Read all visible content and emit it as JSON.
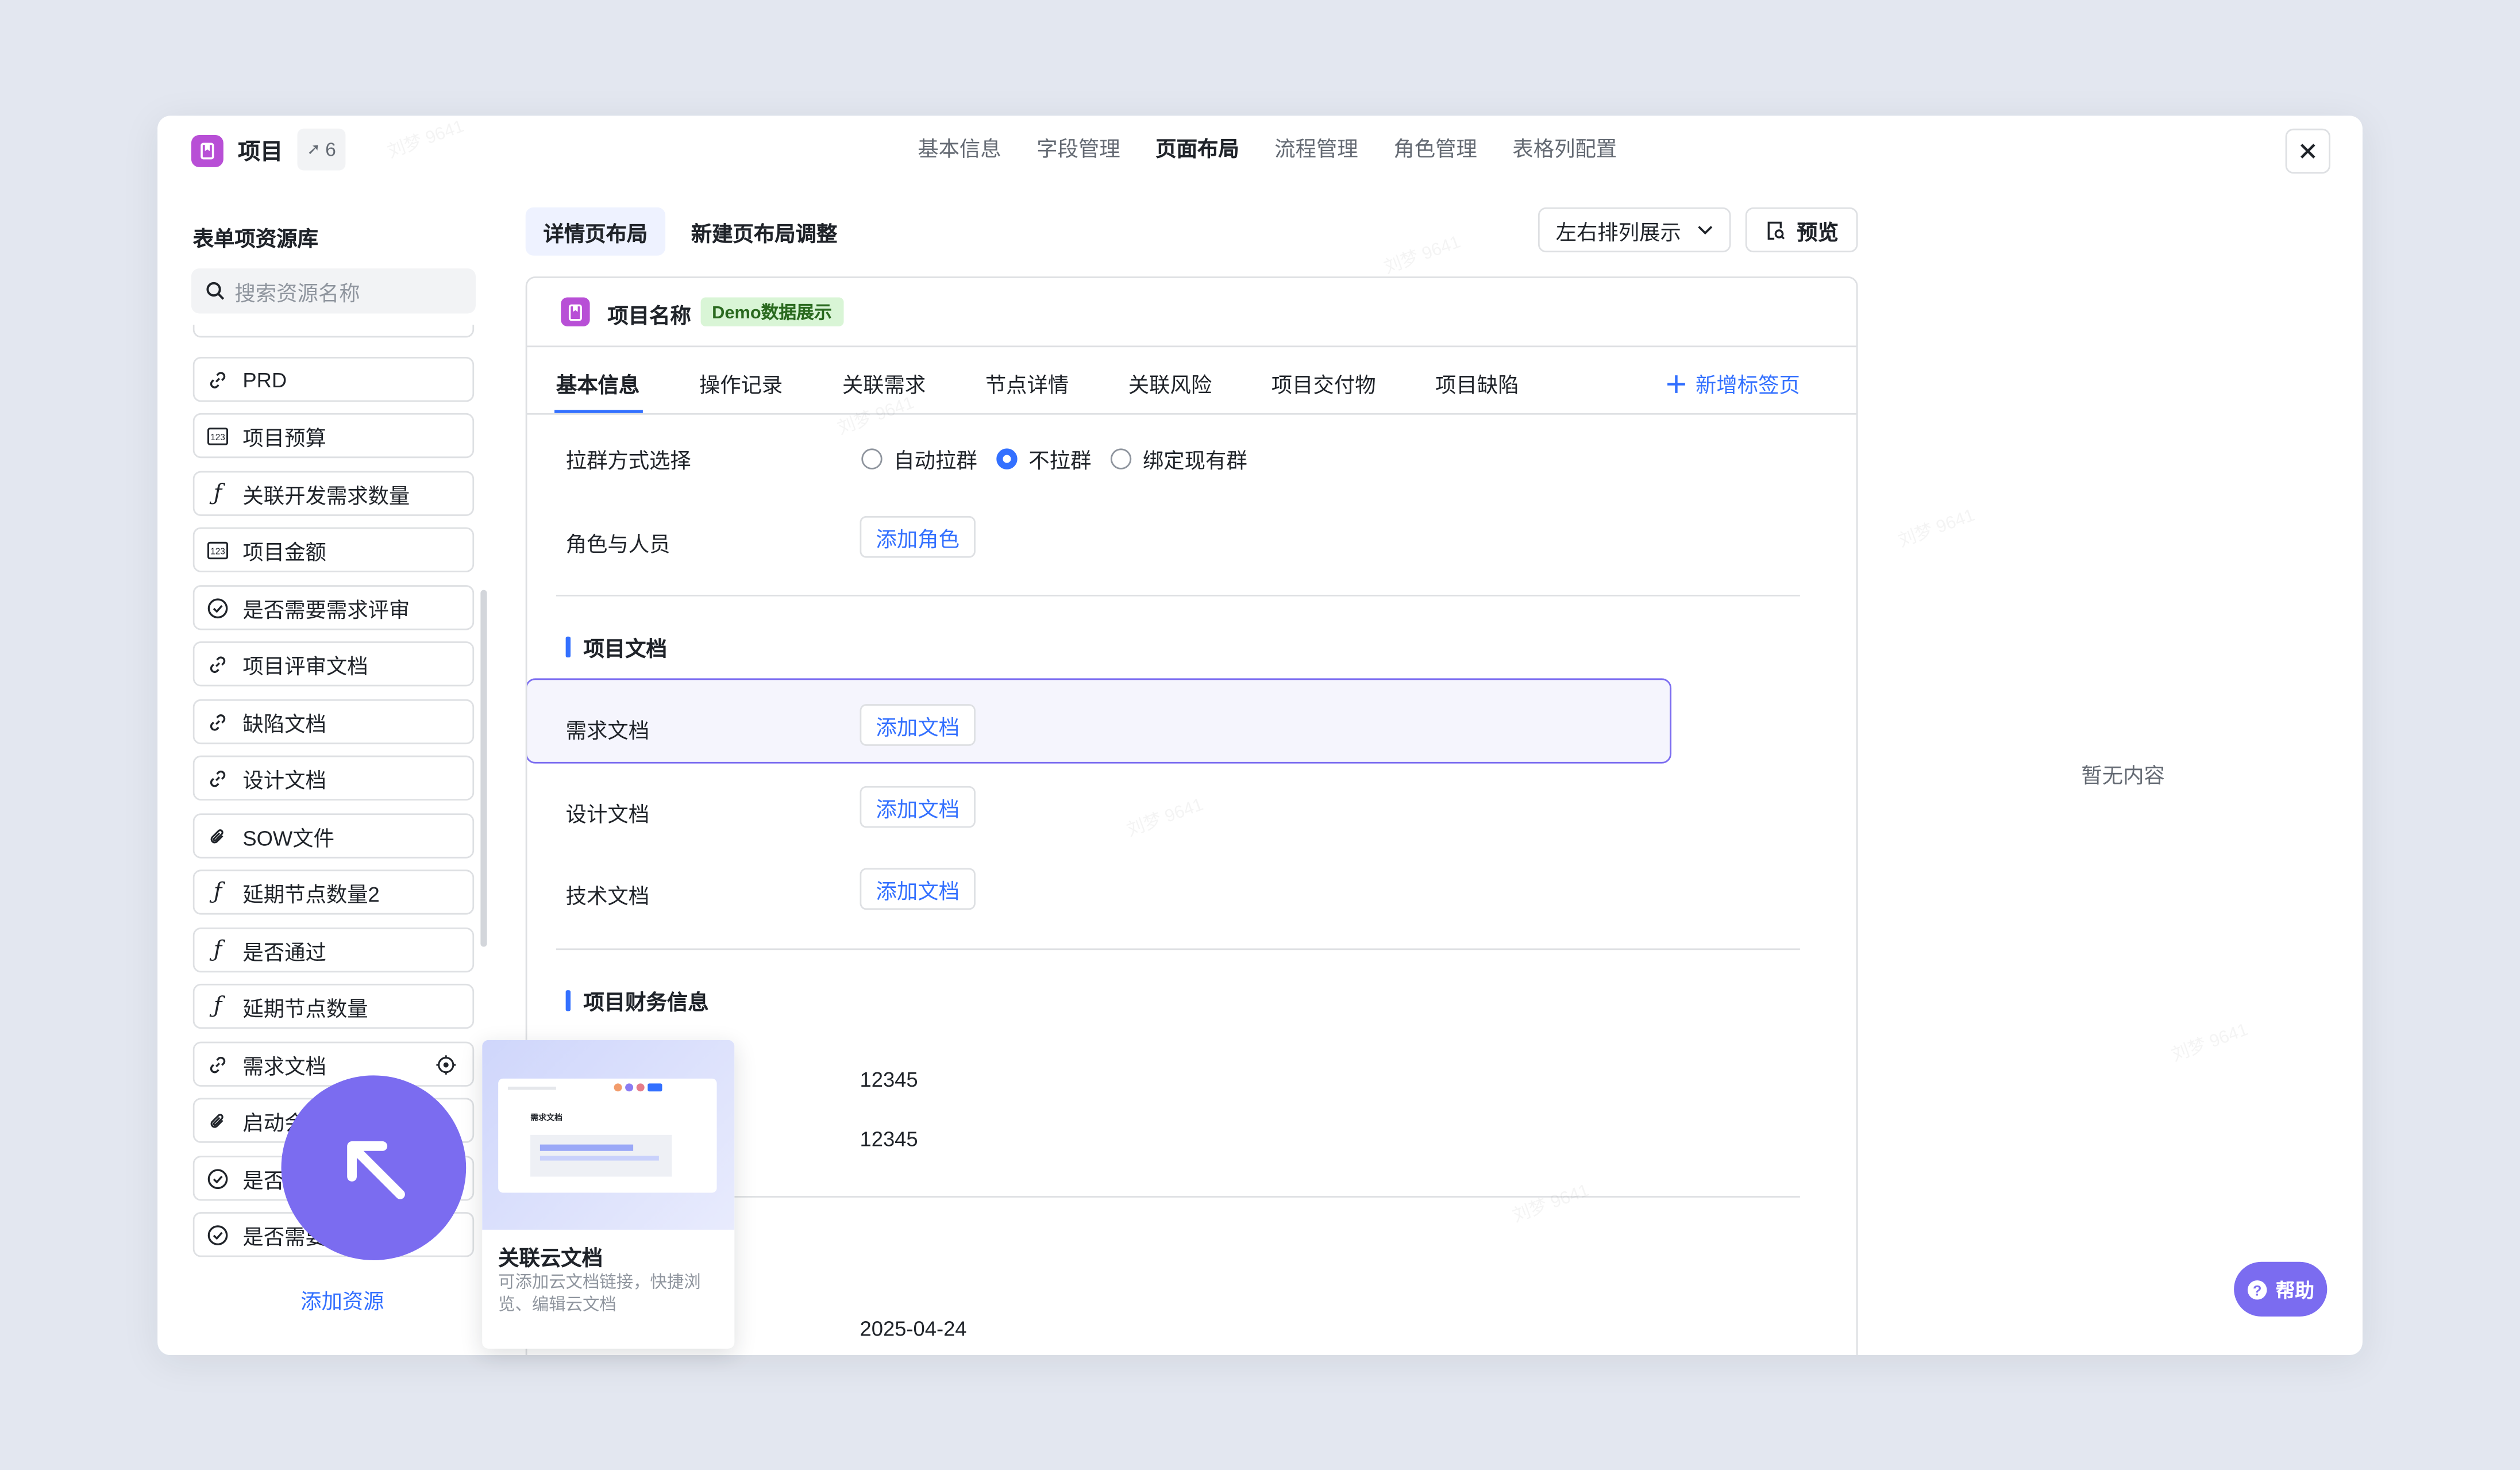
{
  "header": {
    "app_name": "项目",
    "badge_count": "6",
    "tabs": [
      "基本信息",
      "字段管理",
      "页面布局",
      "流程管理",
      "角色管理",
      "表格列配置"
    ],
    "active_tab": "页面布局"
  },
  "sidebar": {
    "title": "表单项资源库",
    "search_placeholder": "搜索资源名称",
    "items": [
      {
        "icon": "link-icon",
        "label": "PRD"
      },
      {
        "icon": "number-icon",
        "label": "项目预算"
      },
      {
        "icon": "formula-icon",
        "label": "关联开发需求数量"
      },
      {
        "icon": "number-icon",
        "label": "项目金额"
      },
      {
        "icon": "check-circle-icon",
        "label": "是否需要需求评审"
      },
      {
        "icon": "link-icon",
        "label": "项目评审文档"
      },
      {
        "icon": "link-icon",
        "label": "缺陷文档"
      },
      {
        "icon": "link-icon",
        "label": "设计文档"
      },
      {
        "icon": "attachment-icon",
        "label": "SOW文件"
      },
      {
        "icon": "formula-icon",
        "label": "延期节点数量2"
      },
      {
        "icon": "formula-icon",
        "label": "是否通过"
      },
      {
        "icon": "formula-icon",
        "label": "延期节点数量"
      },
      {
        "icon": "link-icon",
        "label": "需求文档"
      },
      {
        "icon": "attachment-icon",
        "label": "启动会"
      },
      {
        "icon": "check-circle-icon",
        "label": "是否"
      },
      {
        "icon": "check-circle-icon",
        "label": "是否需要"
      }
    ],
    "add_resource": "添加资源"
  },
  "layout": {
    "tabs": [
      "详情页布局",
      "新建页布局调整"
    ],
    "arrangement": "左右排列展示",
    "preview": "预览"
  },
  "card": {
    "title": "项目名称",
    "badge": "Demo数据展示",
    "tabs": [
      "基本信息",
      "操作记录",
      "关联需求",
      "节点详情",
      "关联风险",
      "项目交付物",
      "项目缺陷"
    ],
    "new_tab": "新增标签页",
    "group_chat_label": "拉群方式选择",
    "group_chat_options": [
      "自动拉群",
      "不拉群",
      "绑定现有群"
    ],
    "group_chat_selected": "不拉群",
    "roles_label": "角色与人员",
    "add_role": "添加角色",
    "doc_section": "项目文档",
    "docs": [
      {
        "label": "需求文档",
        "action": "添加文档"
      },
      {
        "label": "设计文档",
        "action": "添加文档"
      },
      {
        "label": "技术文档",
        "action": "添加文档"
      }
    ],
    "finance_section": "项目财务信息",
    "finance_values": [
      "12345",
      "12345"
    ],
    "date_value": "2025-04-24"
  },
  "right_panel": {
    "empty_text": "暂无内容"
  },
  "help": "帮助",
  "tooltip": {
    "thumb_label": "需求文档",
    "title": "关联云文档",
    "description": "可添加云文档链接，快捷浏览、编辑云文档"
  },
  "watermark": "刘梦 9641",
  "colors": {
    "accent": "#3370ff",
    "purple": "#7b6cf0",
    "app_icon": "#b84fd6"
  }
}
